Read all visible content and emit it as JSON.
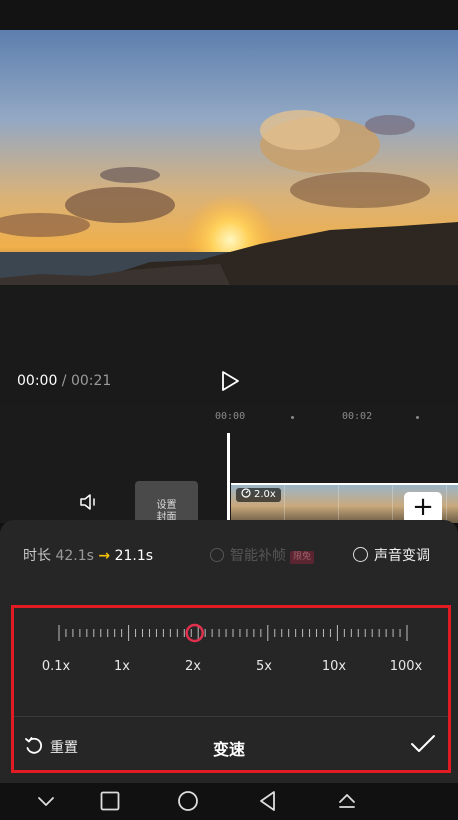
{
  "player": {
    "current_time": "00:00",
    "separator": " / ",
    "total_time": "00:21"
  },
  "timeline": {
    "ruler_labels": [
      "00:00",
      "00:02"
    ],
    "cover_label_line1": "设置",
    "cover_label_line2": "封面",
    "clip_speed_tag": "2.0x",
    "add_clip_label": "+"
  },
  "speed_panel": {
    "duration_label": "时长",
    "duration_old": "42.1s",
    "duration_arrow": "→",
    "duration_new": "21.1s",
    "smart_interp_label": "智能补帧",
    "smart_interp_badge": "限免",
    "smart_interp_enabled": false,
    "pitch_label": "声音变调",
    "pitch_enabled": false,
    "speed_labels": [
      "0.1x",
      "1x",
      "2x",
      "5x",
      "10x",
      "100x"
    ],
    "selected_speed": "2x",
    "slider_position_fraction": 0.39,
    "reset_label": "重置",
    "title": "变速"
  },
  "colors": {
    "accent": "#e0304e",
    "highlight_box": "#e01b24",
    "duration_arrow": "#f2c200"
  },
  "icons": {
    "play": "play-icon",
    "volume": "volume-icon",
    "reset": "undo-icon",
    "confirm": "check-icon",
    "nav_back_collapse": "chevron-down-icon",
    "nav_square": "square-icon",
    "nav_home": "circle-icon",
    "nav_back": "triangle-back-icon",
    "nav_eject": "eject-icon"
  }
}
